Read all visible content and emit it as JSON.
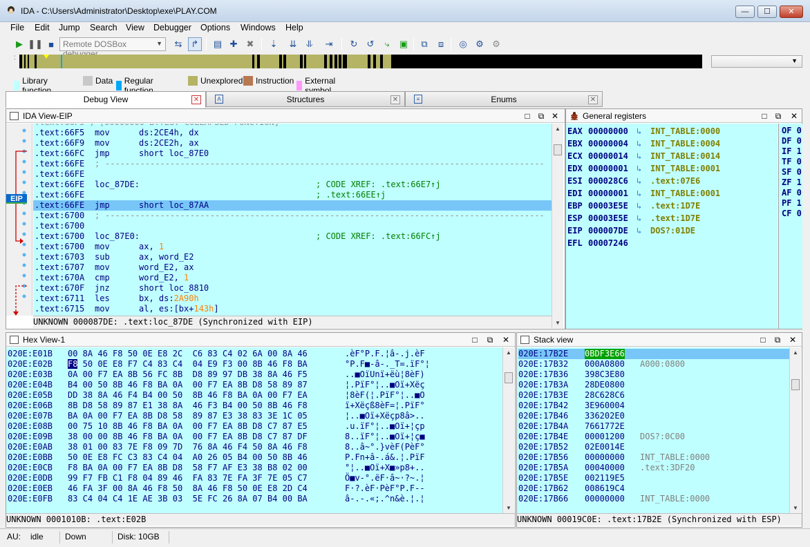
{
  "window": {
    "title": "IDA - C:\\Users\\Administrator\\Desktop\\exe\\PLAY.COM",
    "controls": {
      "minimize": "—",
      "maximize": "☐",
      "close": "✕"
    }
  },
  "menu": [
    "File",
    "Edit",
    "Jump",
    "Search",
    "View",
    "Debugger",
    "Options",
    "Windows",
    "Help"
  ],
  "toolbar": {
    "debugger_select": "Remote DOSBox debugger",
    "debugger_options": [
      "Remote DOSBox debugger"
    ]
  },
  "legend": [
    {
      "label": "Library function",
      "color": "#c0ffff"
    },
    {
      "label": "Data",
      "color": "#c8c8c8"
    },
    {
      "label": "Regular function",
      "color": "#00a8f8"
    },
    {
      "label": "Unexplored",
      "color": "#b4b464"
    },
    {
      "label": "Instruction",
      "color": "#b87850"
    },
    {
      "label": "External symbol",
      "color": "#ff98ff"
    }
  ],
  "tabs": [
    {
      "label": "Debug View",
      "active": true,
      "close": "✕"
    },
    {
      "label": "Structures",
      "active": false,
      "close": "✕"
    },
    {
      "label": "Enums",
      "active": false,
      "close": "✕"
    }
  ],
  "ida_view": {
    "title": "IDA View-EIP",
    "eip_label": "EIP",
    "top_partial": ".text:66F5 ; [00000000 BYTES: COLLAPSED FUNCTION]",
    "lines": [
      {
        "addr": ".text:66F5",
        "mn": "mov",
        "op": "ds:2CE4h, dx"
      },
      {
        "addr": ".text:66F9",
        "mn": "mov",
        "op": "ds:2CE2h, ax"
      },
      {
        "addr": ".text:66FC",
        "mn": "jmp",
        "op": "short loc_87E0"
      },
      {
        "addr": ".text:66FE",
        "mn": ";",
        "op": "",
        "dashes": true
      },
      {
        "addr": ".text:66FE",
        "mn": "",
        "op": ""
      },
      {
        "addr": ".text:66FE",
        "mn": "loc_87DE:",
        "op": "",
        "cm": "; CODE XREF: .text:66E7↑j"
      },
      {
        "addr": ".text:66FE",
        "mn": "",
        "op": "",
        "cm": "; .text:66EE↑j"
      },
      {
        "addr": ".text:66FE",
        "mn": "jmp",
        "op": "short loc_87AA",
        "hi": true
      },
      {
        "addr": ".text:6700",
        "mn": ";",
        "op": "",
        "dashes": true
      },
      {
        "addr": ".text:6700",
        "mn": "",
        "op": ""
      },
      {
        "addr": ".text:6700",
        "mn": "loc_87E0:",
        "op": "",
        "cm": "; CODE XREF: .text:66FC↑j"
      },
      {
        "addr": ".text:6700",
        "mn": "mov",
        "op": "ax, ",
        "num": "1"
      },
      {
        "addr": ".text:6703",
        "mn": "sub",
        "op": "ax, word_E2"
      },
      {
        "addr": ".text:6707",
        "mn": "mov",
        "op": "word_E2, ax"
      },
      {
        "addr": ".text:670A",
        "mn": "cmp",
        "op": "word_E2, ",
        "num": "1"
      },
      {
        "addr": ".text:670F",
        "mn": "jnz",
        "op": "short loc_8810"
      },
      {
        "addr": ".text:6711",
        "mn": "les",
        "op": "bx, ds:",
        "num": "2A90h"
      },
      {
        "addr": ".text:6715",
        "mn": "mov",
        "op": "al, es:[bx+",
        "num": "143h",
        "tail": "]"
      }
    ],
    "status": "UNKNOWN 000087DE: .text:loc_87DE (Synchronized with EIP)"
  },
  "registers": {
    "title": "General registers",
    "rows": [
      {
        "name": "EAX",
        "value": "00000000",
        "target": "INT_TABLE:0000"
      },
      {
        "name": "EBX",
        "value": "00000004",
        "target": "INT_TABLE:0004"
      },
      {
        "name": "ECX",
        "value": "00000014",
        "target": "INT_TABLE:0014"
      },
      {
        "name": "EDX",
        "value": "00000001",
        "target": "INT_TABLE:0001"
      },
      {
        "name": "ESI",
        "value": "000028C6",
        "target": ".text:07E6"
      },
      {
        "name": "EDI",
        "value": "00000001",
        "target": "INT_TABLE:0001"
      },
      {
        "name": "EBP",
        "value": "00003E5E",
        "target": ".text:1D7E"
      },
      {
        "name": "ESP",
        "value": "00003E5E",
        "target": ".text:1D7E"
      },
      {
        "name": "EIP",
        "value": "000007DE",
        "target": "DOS?:01DE"
      },
      {
        "name": "EFL",
        "value": "00007246",
        "target": ""
      }
    ],
    "flags": [
      "OF 0",
      "DF 0",
      "IF 1",
      "TF 0",
      "SF 0",
      "ZF 1",
      "AF 0",
      "PF 1",
      "CF 0"
    ]
  },
  "hex_view": {
    "title": "Hex View-1",
    "rows": [
      {
        "addr": "020E:E01B",
        "bytes": "00 8A 46 F8 50 0E E8 2C  C6 83 C4 02 6A 00 8A 46",
        "ascii": ".èF°P.F.¦â-.j.èF"
      },
      {
        "addr": "020E:E02B",
        "sel": "F8",
        "bytes": " 50 0E E8 F7 C4 83 C4  04 E9 F3 00 8B 46 F8 BA",
        "ascii": "°P.F■-â-._T=.ïF°¦"
      },
      {
        "addr": "020E:E03B",
        "bytes": "0A 00 F7 EA 8B 56 FC 8B  D8 89 97 DB 38 8A 46 F5",
        "ascii": "..■OïUnï+ëù¦8èF)"
      },
      {
        "addr": "020E:E04B",
        "bytes": "B4 00 50 8B 46 F8 BA 0A  00 F7 EA 8B D8 58 89 87",
        "ascii": "¦.PïF°¦..■Oï+Xëç"
      },
      {
        "addr": "020E:E05B",
        "bytes": "DD 38 8A 46 F4 B4 00 50  8B 46 F8 BA 0A 00 F7 EA",
        "ascii": "¦8èF(¦.PïF°¦..■O"
      },
      {
        "addr": "020E:E06B",
        "bytes": "8B D8 58 89 87 E1 38 8A  46 F3 B4 00 50 8B 46 F8",
        "ascii": "ï+Xëçß8èF=¦.PïF°"
      },
      {
        "addr": "020E:E07B",
        "bytes": "BA 0A 00 F7 EA 8B D8 58  89 87 E3 38 83 3E 1C 05",
        "ascii": "¦..■Oï+Xëçp8â>.."
      },
      {
        "addr": "020E:E08B",
        "bytes": "00 75 10 8B 46 F8 BA 0A  00 F7 EA 8B D8 C7 87 E5",
        "ascii": ".u.ïF°¦..■Oï+¦çp"
      },
      {
        "addr": "020E:E09B",
        "bytes": "38 00 00 8B 46 F8 BA 0A  00 F7 EA 8B D8 C7 87 DF",
        "ascii": "8..ïF°¦..■Oï+¦ç■"
      },
      {
        "addr": "020E:E0AB",
        "bytes": "38 01 00 83 7E F8 09 7D  76 8A 46 F4 50 8A 46 F8",
        "ascii": "8..â~°.}vèF(PèF°"
      },
      {
        "addr": "020E:E0BB",
        "bytes": "50 0E E8 FC C3 83 C4 04  A0 26 05 B4 00 50 8B 46",
        "ascii": "P.Fn+â-.á&.¦.PïF"
      },
      {
        "addr": "020E:E0CB",
        "bytes": "F8 BA 0A 00 F7 EA 8B D8  58 F7 AF E3 38 B8 02 00",
        "ascii": "°¦..■Oï+X■»p8+.."
      },
      {
        "addr": "020E:E0DB",
        "bytes": "99 F7 FB C1 F8 04 89 46  FA 83 7E FA 3F 7E 05 C7",
        "ascii": "Ö■v-°.ëF·â~·?~.¦"
      },
      {
        "addr": "020E:E0EB",
        "bytes": "46 FA 3F 00 8A 46 F8 50  8A 46 F8 50 0E E8 2D C4",
        "ascii": "F·?.èF·PèF°P.F--"
      },
      {
        "addr": "020E:E0FB",
        "bytes": "83 C4 04 C4 1E AE 3B 03  5E FC 26 8A 07 B4 00 BA",
        "ascii": "â-.-.«;.^n&è.¦.¦"
      }
    ],
    "status": "UNKNOWN 0001010B: .text:E02B"
  },
  "stack_view": {
    "title": "Stack view",
    "rows": [
      {
        "addr": "020E:17B2E",
        "value": "0BDF3E66",
        "comment": "",
        "hi": true
      },
      {
        "addr": "020E:17B32",
        "value": "000A0800",
        "comment": "A000:0800"
      },
      {
        "addr": "020E:17B36",
        "value": "398C3E80",
        "comment": ""
      },
      {
        "addr": "020E:17B3A",
        "value": "28DE0800",
        "comment": ""
      },
      {
        "addr": "020E:17B3E",
        "value": "28C628C6",
        "comment": ""
      },
      {
        "addr": "020E:17B42",
        "value": "3E960004",
        "comment": ""
      },
      {
        "addr": "020E:17B46",
        "value": "336202E0",
        "comment": ""
      },
      {
        "addr": "020E:17B4A",
        "value": "7661772E",
        "comment": ""
      },
      {
        "addr": "020E:17B4E",
        "value": "00001200",
        "comment": "DOS?:0C00"
      },
      {
        "addr": "020E:17B52",
        "value": "02E0014E",
        "comment": ""
      },
      {
        "addr": "020E:17B56",
        "value": "00000000",
        "comment": "INT_TABLE:0000"
      },
      {
        "addr": "020E:17B5A",
        "value": "00040000",
        "comment": ".text:3DF20"
      },
      {
        "addr": "020E:17B5E",
        "value": "002119E5",
        "comment": ""
      },
      {
        "addr": "020E:17B62",
        "value": "008619C4",
        "comment": ""
      },
      {
        "addr": "020E:17B66",
        "value": "00000000",
        "comment": "INT_TABLE:0000"
      }
    ],
    "status": "UNKNOWN 00019C0E: .text:17B2E (Synchronized with ESP)"
  },
  "statusbar": {
    "au_label": "AU:",
    "au_value": "idle",
    "state": "Down",
    "disk": "Disk: 10GB"
  },
  "colors": {
    "code_bg": "#c0ffff",
    "highlight": "#78c6f8",
    "code_text": "#000080",
    "number": "#ff8000",
    "comment": "#008000"
  }
}
